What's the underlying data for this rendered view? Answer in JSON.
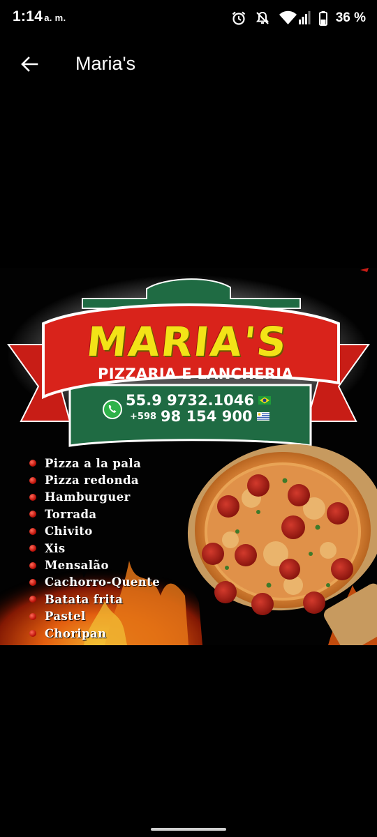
{
  "status_bar": {
    "time": "1:14",
    "ampm": "a. m.",
    "battery": "36 %",
    "icons": [
      "alarm-icon",
      "notifications-off-icon",
      "wifi-icon",
      "signal-icon",
      "battery-icon"
    ]
  },
  "app_bar": {
    "back_icon": "arrow-back-icon",
    "title": "Maria's"
  },
  "poster": {
    "brand": "MARIA'S",
    "subtitle": "PIZZARIA E LANCHERIA",
    "phone_1": "55.9 9732.1046",
    "phone_2_prefix": "+598",
    "phone_2": "98 154 900",
    "menu": [
      "Pizza a la pala",
      "Pizza redonda",
      "Hamburguer",
      "Torrada",
      "Chivito",
      "Xis",
      "Mensalão",
      "Cachorro-Quente",
      "Batata frita",
      "Pastel",
      "Choripan"
    ],
    "colors": {
      "banner_red": "#d9231b",
      "arch_green": "#1f6b43",
      "brand_yellow": "#f3e317"
    }
  }
}
